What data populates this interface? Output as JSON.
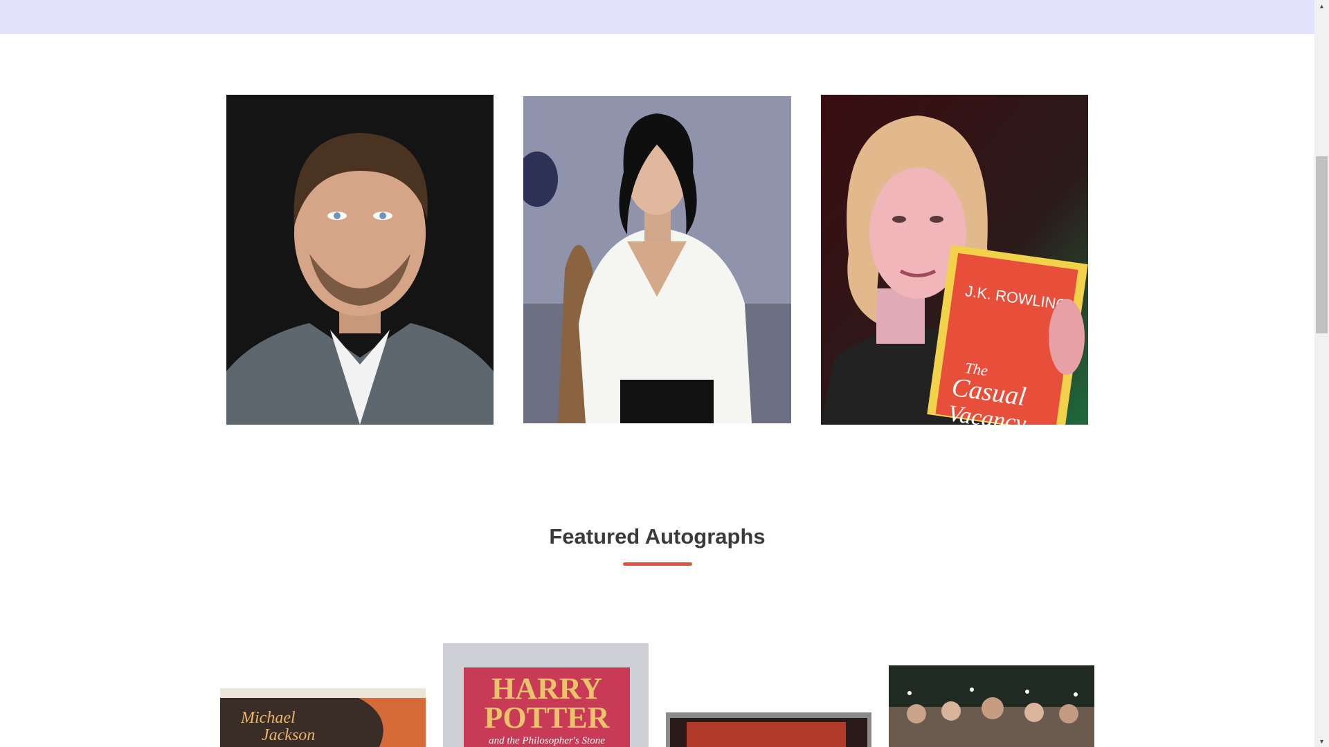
{
  "featured": {
    "title": "Featured Autographs"
  },
  "celebrities": [
    {
      "name": "leonardo-dicaprio",
      "bg": "#141414"
    },
    {
      "name": "michael-jackson",
      "bg": "#8f93ab"
    },
    {
      "name": "jk-rowling",
      "bg": "#4a1214"
    }
  ],
  "autographs": [
    {
      "name": "michael-jackson-thriller-album",
      "cover_text_1": "Michael",
      "cover_text_2": "Jackson"
    },
    {
      "name": "harry-potter-book",
      "line1": "HARRY",
      "line2": "POTTER",
      "line3": "and the Philosopher's Stone"
    },
    {
      "name": "cd-case"
    },
    {
      "name": "concert-crowd-photo"
    }
  ],
  "book_prop": {
    "author": "J.K. ROWLING",
    "title_1": "The",
    "title_2": "Casual",
    "title_3": "Vacancy"
  },
  "colors": {
    "top_band": "#e2e2fd",
    "accent": "#e5533e",
    "heading": "#3a3a3a"
  }
}
